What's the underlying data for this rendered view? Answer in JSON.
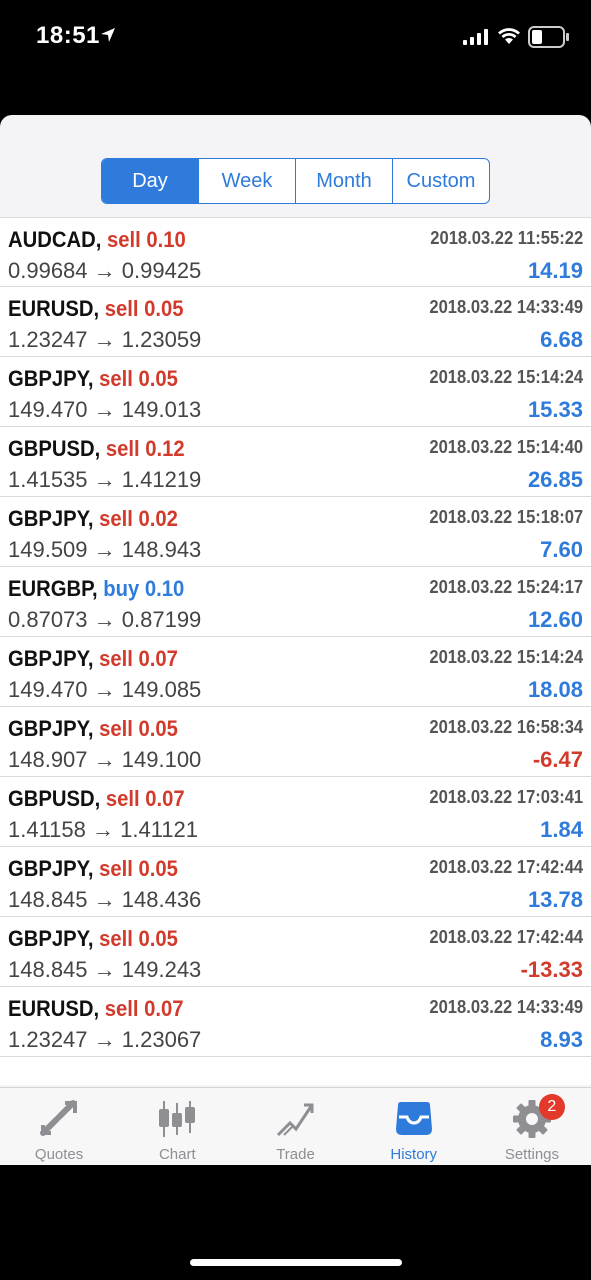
{
  "status": {
    "time": "18:51"
  },
  "filter": {
    "segments": [
      "Day",
      "Week",
      "Month",
      "Custom"
    ],
    "selected": "Day"
  },
  "trades": [
    {
      "symbol": "AUDCAD,",
      "side": "sell 0.10",
      "open": "0.99684",
      "close": "0.99425",
      "time": "2018.03.22 11:55:22",
      "profit": "14.19",
      "negative": false
    },
    {
      "symbol": "EURUSD,",
      "side": "sell 0.05",
      "open": "1.23247",
      "close": "1.23059",
      "time": "2018.03.22 14:33:49",
      "profit": "6.68",
      "negative": false
    },
    {
      "symbol": "GBPJPY,",
      "side": "sell 0.05",
      "open": "149.470",
      "close": "149.013",
      "time": "2018.03.22 15:14:24",
      "profit": "15.33",
      "negative": false
    },
    {
      "symbol": "GBPUSD,",
      "side": "sell 0.12",
      "open": "1.41535",
      "close": "1.41219",
      "time": "2018.03.22 15:14:40",
      "profit": "26.85",
      "negative": false
    },
    {
      "symbol": "GBPJPY,",
      "side": "sell 0.02",
      "open": "149.509",
      "close": "148.943",
      "time": "2018.03.22 15:18:07",
      "profit": "7.60",
      "negative": false
    },
    {
      "symbol": "EURGBP,",
      "side": "buy 0.10",
      "open": "0.87073",
      "close": "0.87199",
      "time": "2018.03.22 15:24:17",
      "profit": "12.60",
      "negative": false
    },
    {
      "symbol": "GBPJPY,",
      "side": "sell 0.07",
      "open": "149.470",
      "close": "149.085",
      "time": "2018.03.22 15:14:24",
      "profit": "18.08",
      "negative": false
    },
    {
      "symbol": "GBPJPY,",
      "side": "sell 0.05",
      "open": "148.907",
      "close": "149.100",
      "time": "2018.03.22 16:58:34",
      "profit": "-6.47",
      "negative": true
    },
    {
      "symbol": "GBPUSD,",
      "side": "sell 0.07",
      "open": "1.41158",
      "close": "1.41121",
      "time": "2018.03.22 17:03:41",
      "profit": "1.84",
      "negative": false
    },
    {
      "symbol": "GBPJPY,",
      "side": "sell 0.05",
      "open": "148.845",
      "close": "148.436",
      "time": "2018.03.22 17:42:44",
      "profit": "13.78",
      "negative": false
    },
    {
      "symbol": "GBPJPY,",
      "side": "sell 0.05",
      "open": "148.845",
      "close": "149.243",
      "time": "2018.03.22 17:42:44",
      "profit": "-13.33",
      "negative": true
    },
    {
      "symbol": "EURUSD,",
      "side": "sell 0.07",
      "open": "1.23247",
      "close": "1.23067",
      "time": "2018.03.22 14:33:49",
      "profit": "8.93",
      "negative": false
    }
  ],
  "tabs": [
    {
      "label": "Quotes",
      "icon": "quotes-icon",
      "active": false
    },
    {
      "label": "Chart",
      "icon": "chart-icon",
      "active": false
    },
    {
      "label": "Trade",
      "icon": "trade-icon",
      "active": false
    },
    {
      "label": "History",
      "icon": "history-icon",
      "active": true
    },
    {
      "label": "Settings",
      "icon": "settings-icon",
      "active": false,
      "badge": "2"
    }
  ],
  "colors": {
    "accent": "#2f7bdb",
    "sell": "#d23a2b",
    "loss": "#d23a2b",
    "profit": "#2f7bdb"
  }
}
